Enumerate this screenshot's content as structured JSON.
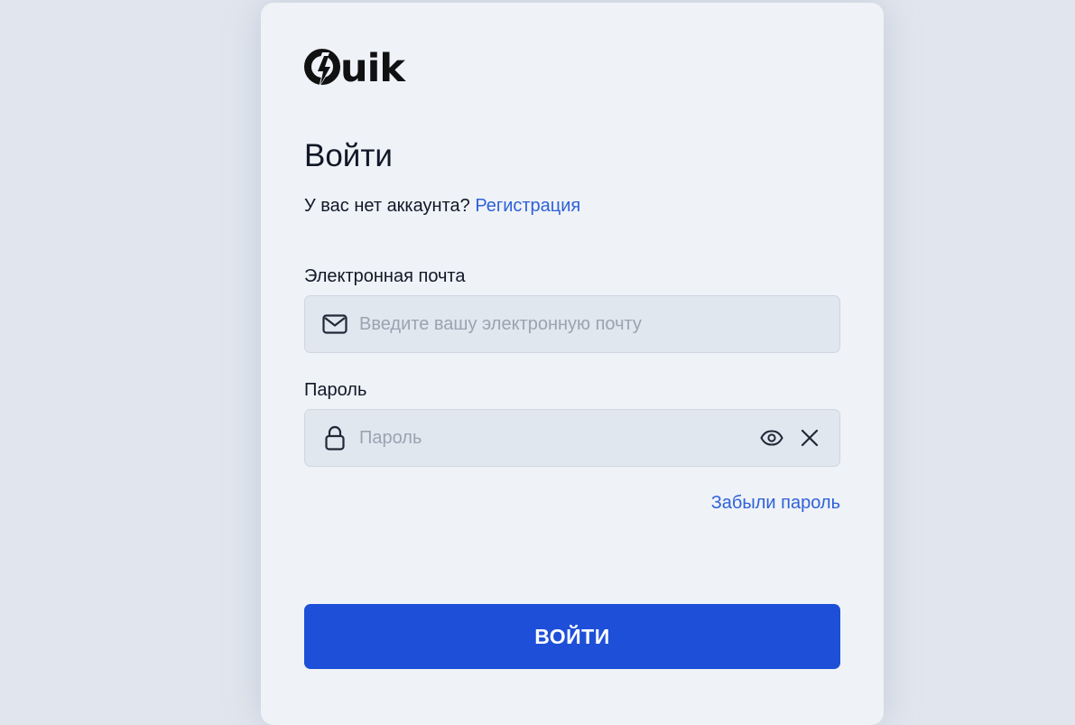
{
  "brand": {
    "logo_text": "uik",
    "logo_icon": "q-lightning-logo"
  },
  "login": {
    "title": "Войти",
    "no_account_text": "У вас нет аккаунта?",
    "register_link": "Регистрация",
    "email": {
      "label": "Электронная почта",
      "placeholder": "Введите вашу электронную почту",
      "value": "",
      "icon": "mail-icon"
    },
    "password": {
      "label": "Пароль",
      "placeholder": "Пароль",
      "value": "",
      "icon": "lock-icon",
      "toggle_icon": "eye-icon",
      "clear_icon": "close-icon"
    },
    "forgot_link": "Забыли пароль",
    "submit_label": "ВОЙТИ"
  },
  "colors": {
    "background": "#e1e6ee",
    "card": "#eff2f7",
    "field": "#e1e7ef",
    "link": "#2f62d8",
    "primary_button": "#1d4fd8"
  }
}
